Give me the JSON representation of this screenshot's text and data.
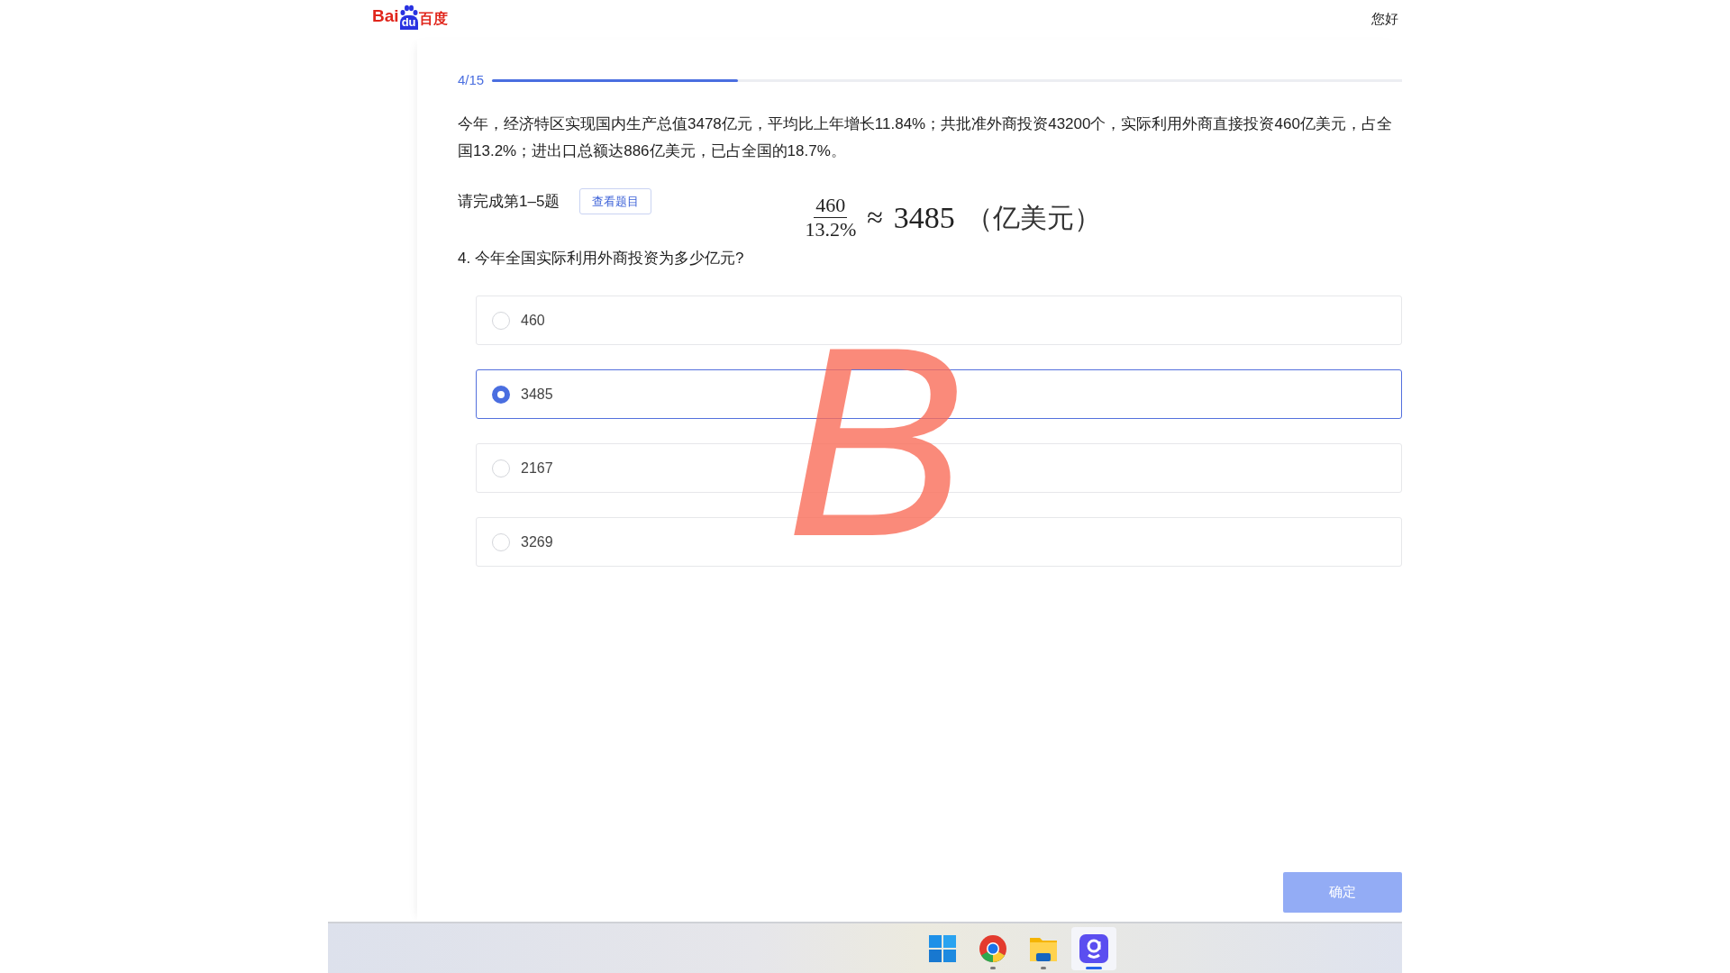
{
  "header": {
    "logo": {
      "left": "Bai",
      "paw": "du",
      "right": "百度"
    },
    "greeting": "您好"
  },
  "progress": {
    "label": "4/15",
    "level": 0.27
  },
  "passage": "今年，经济特区实现国内生产总值3478亿元，平均比上年增长11.84%；共批准外商投资43200个，实际利用外商直接投资460亿美元，占全国13.2%；进出口总额达886亿美元，已占全国的18.7%。",
  "instruction": "请完成第1–5题",
  "view_button": "查看题目",
  "formula": {
    "numerator": "460",
    "denominator": "13.2%",
    "approx": "≈",
    "result": "3485",
    "unit": "（亿美元）"
  },
  "question": "4. 今年全国实际利用外商投资为多少亿元?",
  "options": [
    {
      "label": "460",
      "selected": false
    },
    {
      "label": "3485",
      "selected": true
    },
    {
      "label": "2167",
      "selected": false
    },
    {
      "label": "3269",
      "selected": false
    }
  ],
  "annotation": "B",
  "confirm_button": {
    "label": "确定",
    "disabled": true
  },
  "taskbar": [
    {
      "kind": "start",
      "running": false,
      "selected": false
    },
    {
      "kind": "browser",
      "running": true,
      "selected": false
    },
    {
      "kind": "folder",
      "running": true,
      "selected": false
    },
    {
      "kind": "app",
      "running": true,
      "selected": true
    }
  ]
}
